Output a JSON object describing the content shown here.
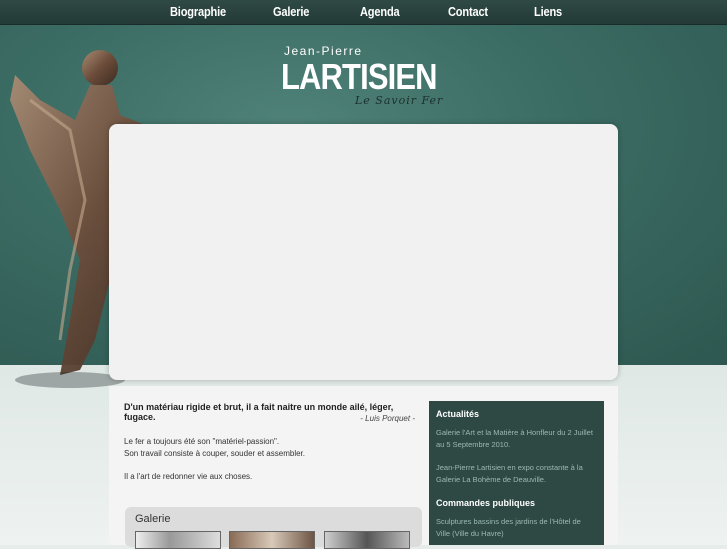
{
  "nav": {
    "items": [
      {
        "label": "Biographie"
      },
      {
        "label": "Galerie"
      },
      {
        "label": "Agenda"
      },
      {
        "label": "Contact"
      },
      {
        "label": "Liens"
      }
    ]
  },
  "logo": {
    "pre": "Jean-Pierre",
    "main": "LARTISIEN",
    "sub": "Le Savoir Fer"
  },
  "intro": {
    "quote": "D'un matériau rigide et brut, il a fait naitre un monde ailé, léger, fugace.",
    "author": "- Luis Porquet -",
    "p1_line1": "Le fer a toujours été son \"matériel-passion\".",
    "p1_line2": "Son travail consiste à couper, souder et assembler.",
    "p2": "Il a l'art de redonner vie aux choses."
  },
  "galerie": {
    "title": "Galerie"
  },
  "sidebar": {
    "actualites_title": "Actualités",
    "actualites_1": "Galerie l'Art et la Matière à Honfleur du 2 Juillet au 5 Septembre 2010.",
    "actualites_2": "Jean-Pierre Lartisien en expo constante à la Galerie La Bohème de Deauville.",
    "commandes_title": "Commandes publiques",
    "commandes_1": "Sculptures bassins des jardins de l'Hôtel de Ville (Ville du Havre)"
  },
  "colors": {
    "nav_bg": "#233a36",
    "hero_bg": "#3b6c63",
    "sidebar_bg": "#2e4944",
    "sidebar_text": "#9cb8b3"
  }
}
